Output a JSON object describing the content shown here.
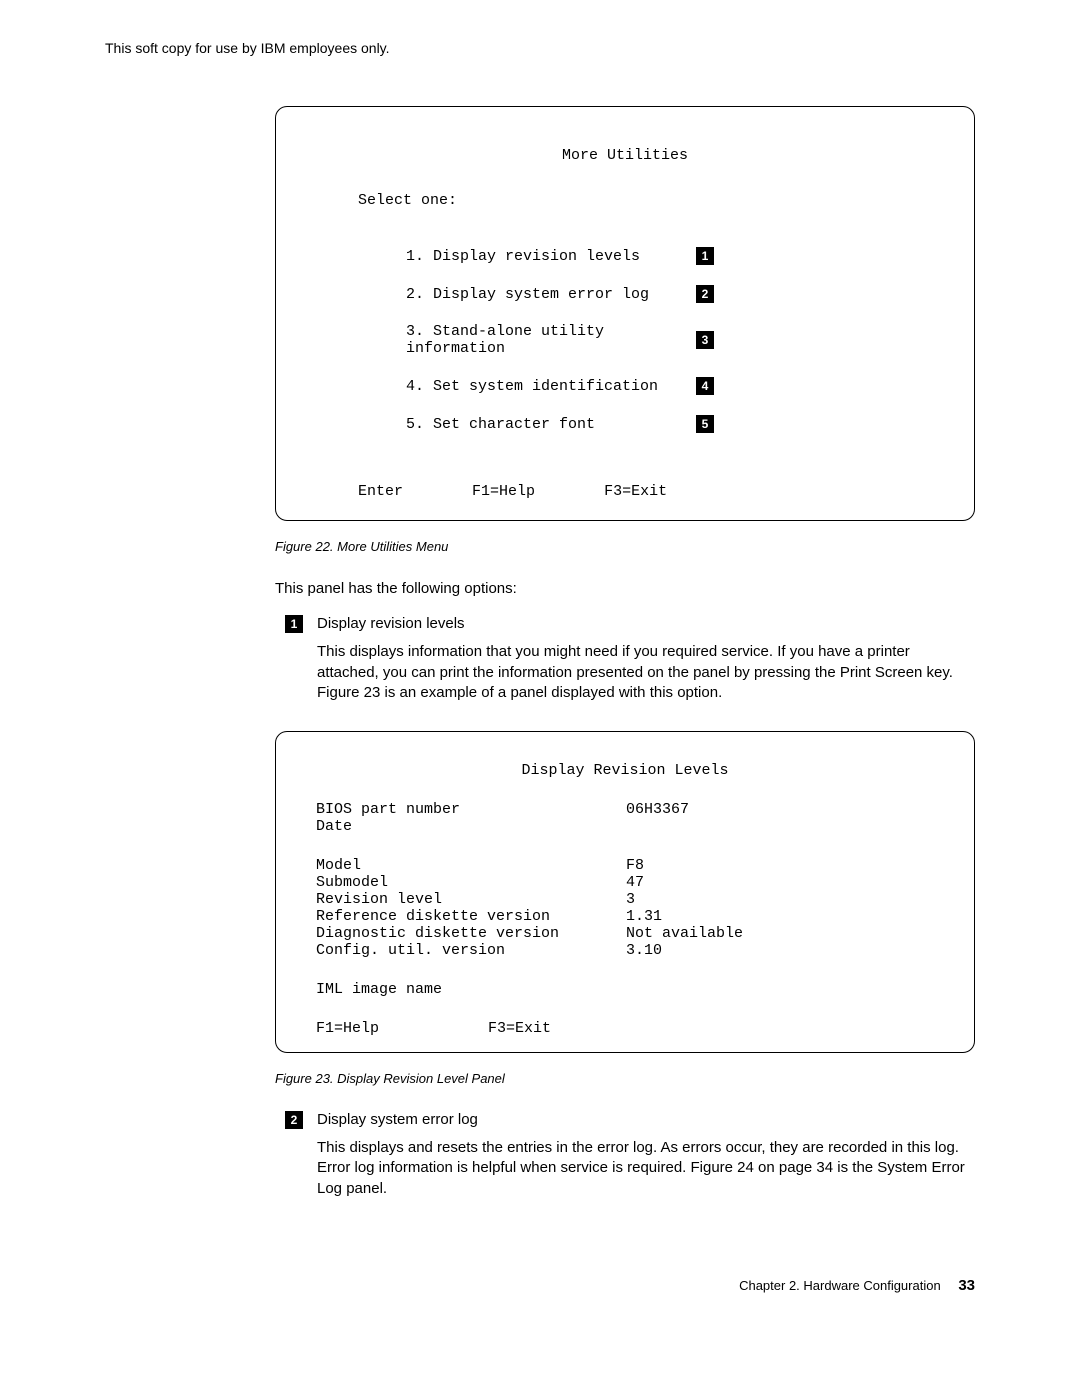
{
  "headerNote": "This soft copy for use by IBM employees only.",
  "panel1": {
    "title": "More Utilities",
    "subtitle": "Select one:",
    "items": [
      {
        "text": "1. Display revision levels",
        "badge": "1"
      },
      {
        "text": "2. Display system error log",
        "badge": "2"
      },
      {
        "text": "3. Stand-alone utility information",
        "badge": "3"
      },
      {
        "text": "4. Set system identification",
        "badge": "4"
      },
      {
        "text": "5. Set character font",
        "badge": "5"
      }
    ],
    "footer": {
      "enter": "Enter",
      "f1": "F1=Help",
      "f3": "F3=Exit"
    }
  },
  "caption1": "Figure  22.  More Utilities Menu",
  "intro": "This panel has the following options:",
  "option1": {
    "badge": "1",
    "title": "Display revision levels",
    "desc": "This displays information that you might need if you required service.  If you have a printer attached, you can print the information presented on the panel by pressing the Print Screen key.  Figure 23 is an example of a panel displayed with this option."
  },
  "panel2": {
    "title": "Display Revision Levels",
    "group1": [
      {
        "label": "BIOS part number",
        "value": "06H3367"
      },
      {
        "label": "Date",
        "value": ""
      }
    ],
    "group2": [
      {
        "label": "Model",
        "value": "F8"
      },
      {
        "label": "Submodel",
        "value": "47"
      },
      {
        "label": "Revision level",
        "value": "3"
      },
      {
        "label": "Reference diskette version",
        "value": "1.31"
      },
      {
        "label": "Diagnostic diskette version",
        "value": "Not available"
      },
      {
        "label": "Config. util. version",
        "value": "3.10"
      }
    ],
    "group3": [
      {
        "label": "IML image name",
        "value": ""
      }
    ],
    "footer": {
      "f1": "F1=Help",
      "f3": "F3=Exit"
    }
  },
  "caption2": "Figure  23.  Display Revision Level Panel",
  "option2": {
    "badge": "2",
    "title": "Display system error log",
    "desc": "This displays and resets the entries in the error log.  As errors occur, they are recorded in this log.  Error log information is helpful when service is required.  Figure 24 on page 34 is the System Error Log panel."
  },
  "footerChapter": "Chapter 2.  Hardware Configuration",
  "pageNum": "33"
}
